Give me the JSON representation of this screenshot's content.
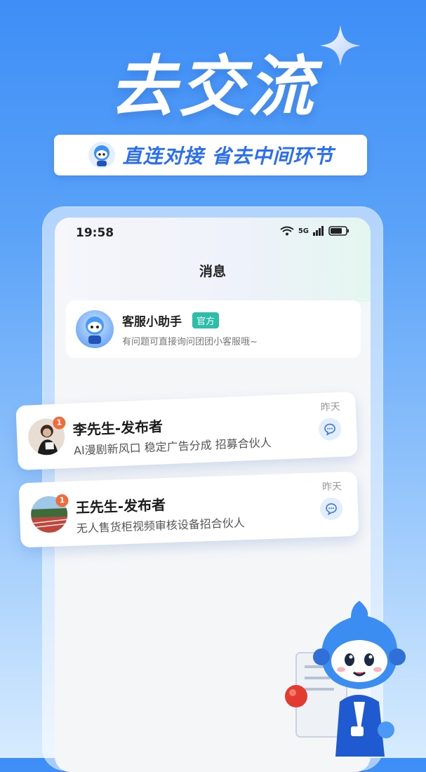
{
  "hero": {
    "title": "去交流"
  },
  "slogan": {
    "text": "直连对接 省去中间环节"
  },
  "phone": {
    "status_time": "19:58",
    "status_network": "5G",
    "page_title": "消息",
    "assistant": {
      "name": "客服小助手",
      "badge": "官方",
      "description": "有问题可直接询问团团小客服哦~"
    },
    "chats": [
      {
        "name": "李先生-发布者",
        "preview": "AI漫剧新风口 稳定广告分成 招募合伙人",
        "time": "昨天",
        "unread": "1"
      },
      {
        "name": "王先生-发布者",
        "preview": "无人售货柜视频审核设备招合伙人",
        "time": "昨天",
        "unread": "1"
      }
    ]
  },
  "colors": {
    "accent": "#2a6ef2",
    "badge_green": "#2bbfa9",
    "unread_orange": "#f06a3a"
  },
  "icons": [
    "sparkle-icon",
    "wifi-icon",
    "signal-icon",
    "battery-icon",
    "chat-bubble-icon",
    "mascot"
  ]
}
